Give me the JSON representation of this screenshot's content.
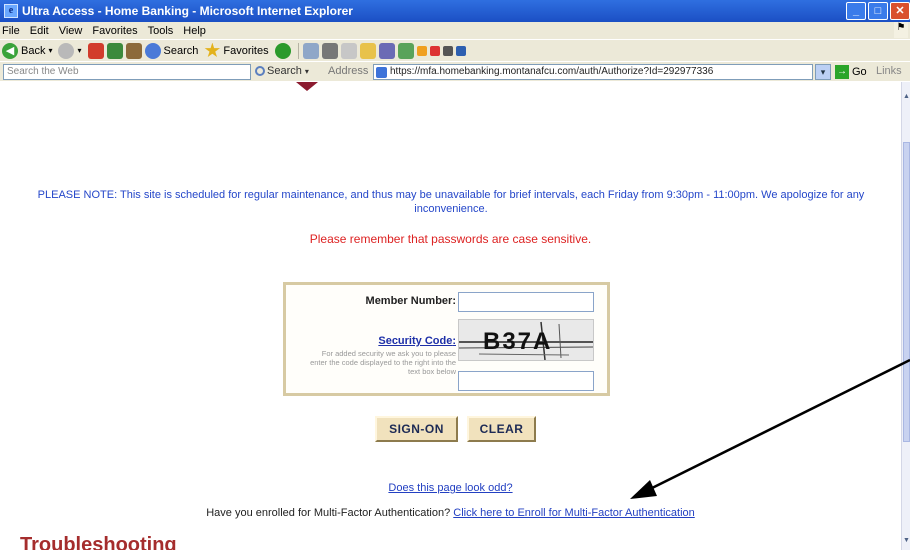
{
  "window": {
    "title": "Ultra Access - Home Banking - Microsoft Internet Explorer",
    "icon": "ie-page-icon"
  },
  "menu": [
    "File",
    "Edit",
    "View",
    "Favorites",
    "Tools",
    "Help"
  ],
  "toolbar": {
    "back": "Back",
    "search": "Search",
    "favorites": "Favorites"
  },
  "addressbar": {
    "search_placeholder": "Search the Web",
    "search_button": "Search",
    "address_label": "Address",
    "url": "https://mfa.homebanking.montanafcu.com/auth/Authorize?Id=292977336",
    "go": "Go",
    "links": "Links"
  },
  "page": {
    "notice": "PLEASE NOTE: This site is scheduled for regular maintenance, and thus may be unavailable for brief intervals, each Friday from 9:30pm - 11:00pm. We apologize for any inconvenience.",
    "reminder": "Please remember that passwords are case sensitive.",
    "member_label": "Member Number:",
    "security_label": "Security Code",
    "security_colon": ":",
    "security_help": "For added security we ask you to please enter the code displayed to the right into the text box below",
    "captcha_text": "B37A",
    "signon": "SIGN-ON",
    "clear": "CLEAR",
    "odd_link": "Does this page look odd?",
    "enroll_prefix": "Have you enrolled for Multi-Factor Authentication? ",
    "enroll_link": "Click here to Enroll for Multi-Factor Authentication",
    "troubleshooting": "Troubleshooting"
  },
  "colors": {
    "notice_text": "#2446c9",
    "reminder_text": "#dd2222",
    "heading": "#a52d2d",
    "button_bg": "#f1e2bd"
  }
}
